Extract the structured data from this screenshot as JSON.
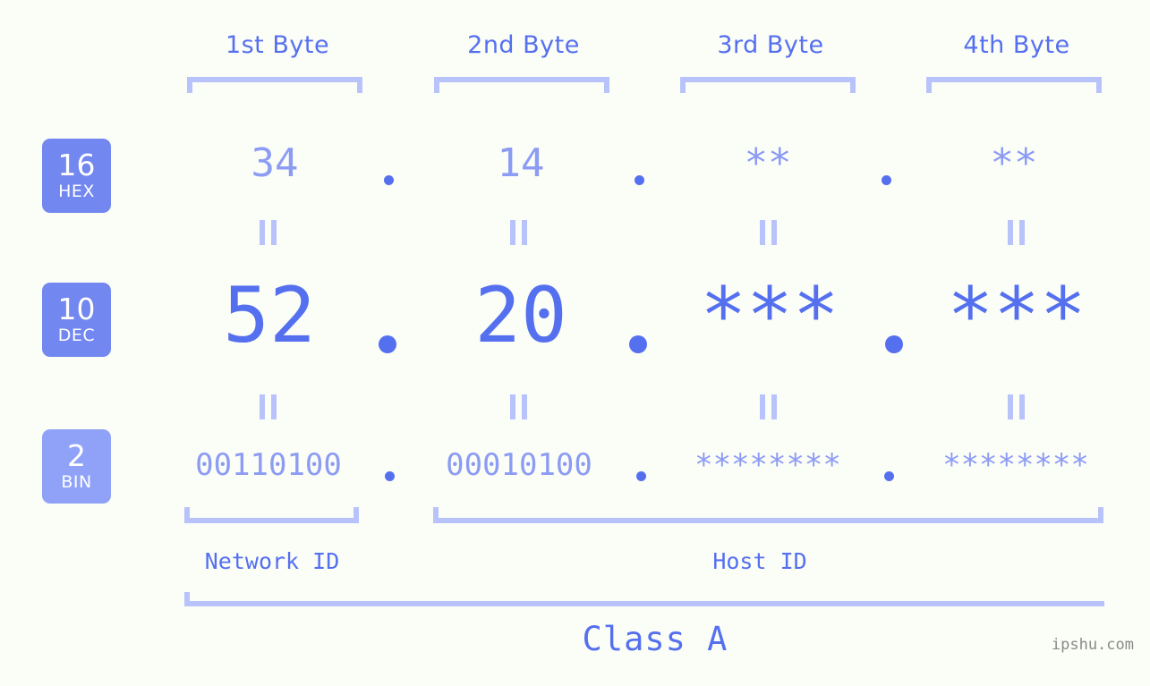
{
  "page": {
    "background_color": "#fbfdf7",
    "accent_color": "#5570ef",
    "accent_light_color": "#8c9bf4",
    "bracket_color": "#b9c3fb",
    "watermark": "ipshu.com"
  },
  "byte_headers": [
    {
      "label": "1st Byte"
    },
    {
      "label": "2nd Byte"
    },
    {
      "label": "3rd Byte"
    },
    {
      "label": "4th Byte"
    }
  ],
  "radix_badges": [
    {
      "number": "16",
      "name": "HEX"
    },
    {
      "number": "10",
      "name": "DEC"
    },
    {
      "number": "2",
      "name": "BIN"
    }
  ],
  "rows": {
    "hex": {
      "radix": "16",
      "radix_name": "HEX",
      "values": [
        "34",
        "14",
        "**",
        "**"
      ],
      "separator": "."
    },
    "dec": {
      "radix": "10",
      "radix_name": "DEC",
      "values": [
        "52",
        "20",
        "***",
        "***"
      ],
      "separator": "."
    },
    "bin": {
      "radix": "2",
      "radix_name": "BIN",
      "values": [
        "00110100",
        "00010100",
        "********",
        "********"
      ],
      "separator": "."
    }
  },
  "equals_marker": "||",
  "sections": [
    {
      "label": "Network ID"
    },
    {
      "label": "Host ID"
    }
  ],
  "class": {
    "label": "Class A"
  }
}
